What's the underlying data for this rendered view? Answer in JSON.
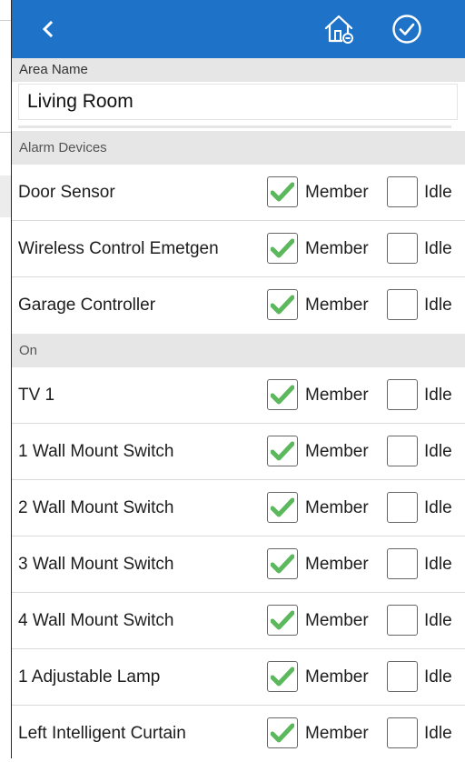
{
  "colors": {
    "header": "#1e73c8",
    "check": "#5cb85c",
    "section_bg": "#e6e6e6"
  },
  "icons": {
    "back": "chevron-left-icon",
    "home": "home-icon",
    "confirm": "check-circle-icon"
  },
  "area": {
    "label": "Area Name",
    "value": "Living Room"
  },
  "sections": [
    {
      "title": "Alarm Devices",
      "devices": [
        {
          "name": "Door Sensor",
          "member_label": "Member",
          "member": true,
          "idle_label": "Idle",
          "idle": false
        },
        {
          "name": "Wireless Control Emetgen",
          "member_label": "Member",
          "member": true,
          "idle_label": "Idle",
          "idle": false
        },
        {
          "name": "Garage Controller",
          "member_label": "Member",
          "member": true,
          "idle_label": "Idle",
          "idle": false
        }
      ]
    },
    {
      "title": "On",
      "devices": [
        {
          "name": "TV 1",
          "member_label": "Member",
          "member": true,
          "idle_label": "Idle",
          "idle": false
        },
        {
          "name": "1 Wall Mount Switch",
          "member_label": "Member",
          "member": true,
          "idle_label": "Idle",
          "idle": false
        },
        {
          "name": "2 Wall Mount Switch",
          "member_label": "Member",
          "member": true,
          "idle_label": "Idle",
          "idle": false
        },
        {
          "name": "3 Wall Mount Switch",
          "member_label": "Member",
          "member": true,
          "idle_label": "Idle",
          "idle": false
        },
        {
          "name": "4 Wall Mount Switch",
          "member_label": "Member",
          "member": true,
          "idle_label": "Idle",
          "idle": false
        },
        {
          "name": "1 Adjustable Lamp",
          "member_label": "Member",
          "member": true,
          "idle_label": "Idle",
          "idle": false
        },
        {
          "name": "Left Intelligent Curtain",
          "member_label": "Member",
          "member": true,
          "idle_label": "Idle",
          "idle": false
        }
      ]
    }
  ]
}
